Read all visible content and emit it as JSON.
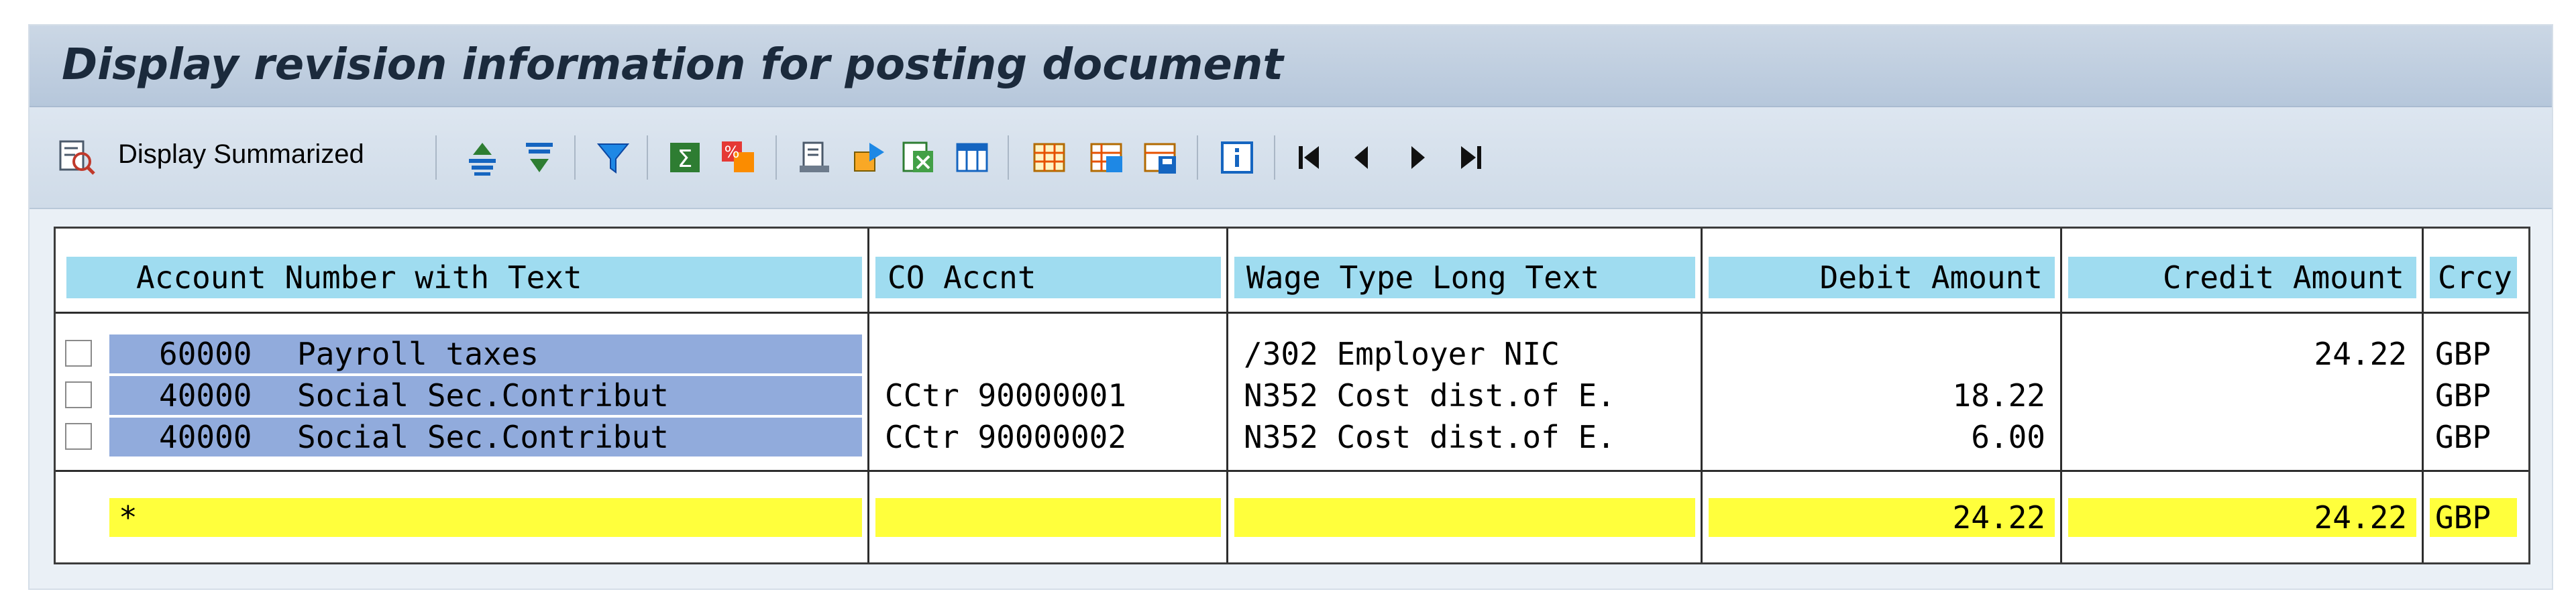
{
  "window": {
    "title": "Display revision information for posting document"
  },
  "toolbar": {
    "display_summarized_label": "Display Summarized",
    "icons": [
      "display-summarized-icon",
      "sort-ascending-icon",
      "sort-descending-icon",
      "filter-icon",
      "total-icon",
      "subtotal-icon",
      "print-preview-icon",
      "export-icon",
      "export-spreadsheet-icon",
      "abc-analysis-icon",
      "change-layout-icon",
      "select-layout-icon",
      "save-layout-icon",
      "information-icon",
      "first-page-icon",
      "previous-page-icon",
      "next-page-icon",
      "last-page-icon"
    ]
  },
  "table": {
    "columns": [
      {
        "label": "Account Number with Text"
      },
      {
        "label": "CO Accnt"
      },
      {
        "label": "Wage Type Long Text"
      },
      {
        "label": "Debit Amount"
      },
      {
        "label": "Credit Amount"
      },
      {
        "label": "Crcy"
      }
    ],
    "rows": [
      {
        "account": "60000",
        "account_text": "Payroll taxes",
        "co_account": "",
        "wage_type": "/302 Employer NIC",
        "debit": "",
        "credit": "24.22",
        "currency": "GBP"
      },
      {
        "account": "40000",
        "account_text": "Social Sec.Contribut",
        "co_account": "CCtr 90000001",
        "wage_type": "N352 Cost dist.of E.",
        "debit": "18.22",
        "credit": "",
        "currency": "GBP"
      },
      {
        "account": "40000",
        "account_text": "Social Sec.Contribut",
        "co_account": "CCtr 90000002",
        "wage_type": "N352 Cost dist.of E.",
        "debit": "6.00",
        "credit": "",
        "currency": "GBP"
      }
    ],
    "total": {
      "marker": "*",
      "debit": "24.22",
      "credit": "24.22",
      "currency": "GBP"
    }
  }
}
